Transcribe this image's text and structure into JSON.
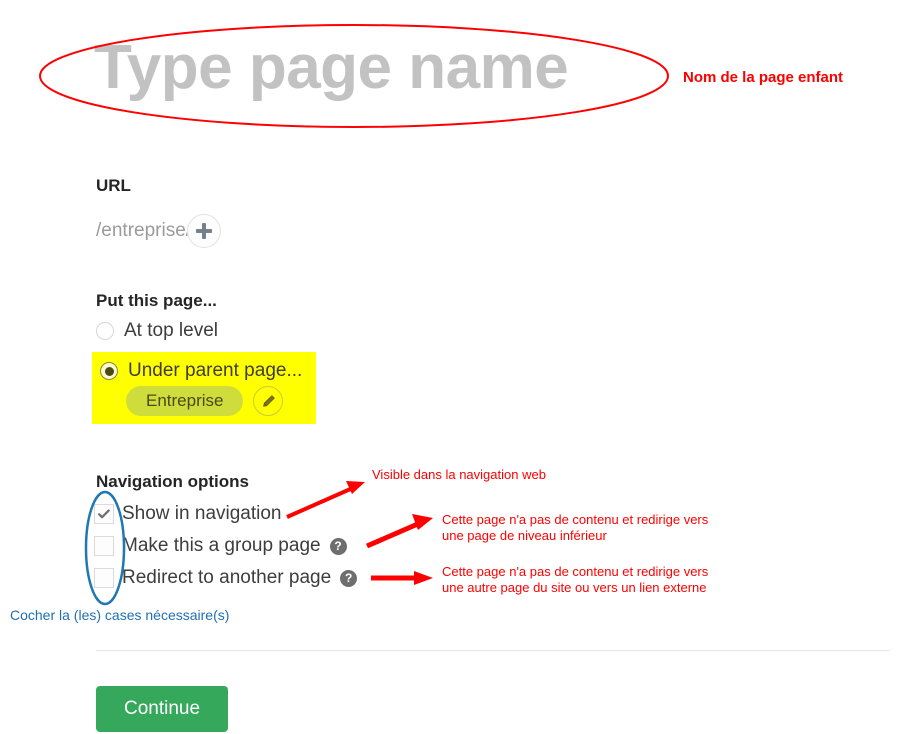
{
  "form": {
    "title_placeholder": "Type page name",
    "url": {
      "label": "URL",
      "value": "/entreprise/",
      "add_icon": "plus-icon"
    },
    "placement": {
      "label": "Put this page...",
      "options": [
        {
          "label": "At top level",
          "selected": false
        },
        {
          "label": "Under parent page...",
          "selected": true
        }
      ],
      "parent_tag": "Entreprise",
      "edit_icon": "pencil-icon"
    },
    "navigation": {
      "label": "Navigation options",
      "checkboxes": [
        {
          "label": "Show in navigation",
          "checked": true,
          "help": false
        },
        {
          "label": "Make this a group page",
          "checked": false,
          "help": true
        },
        {
          "label": "Redirect to another page",
          "checked": false,
          "help": true
        }
      ],
      "help_icon": "question-mark-icon"
    },
    "submit_label": "Continue"
  },
  "annotations": {
    "page_name": "Nom de la page enfant",
    "visible_nav": "Visible dans la navigation web",
    "group_page": "Cette page n'a pas de contenu et redirige vers\nune page de niveau inférieur",
    "redirect_page": "Cette page n'a pas de contenu et redirige vers\nune autre page du site ou vers un lien externe",
    "check_boxes_hint": "Cocher la (les) cases nécessaire(s)"
  },
  "colors": {
    "annotation_red": "#ff0000",
    "highlight_yellow": "#ffff00",
    "tag_green": "#cfdd3c",
    "button_green": "#36a85c",
    "hint_blue": "#1f6fb5",
    "ellipse_blue": "#1f78b4",
    "placeholder_gray": "#c2c2c2"
  }
}
